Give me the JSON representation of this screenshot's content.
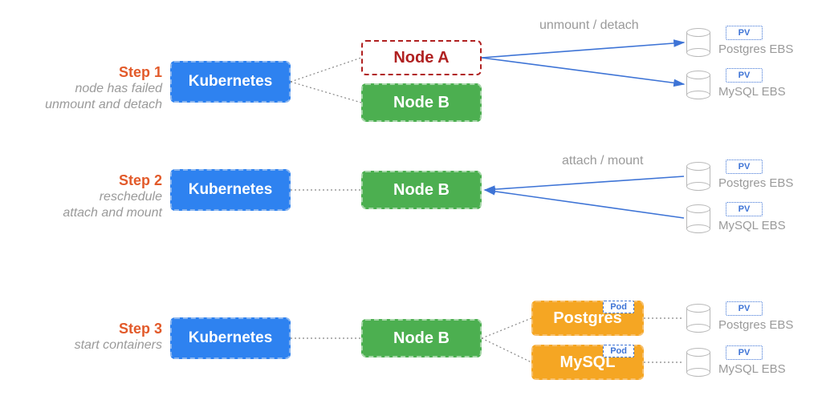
{
  "steps": [
    {
      "title": "Step 1",
      "sub": "node has failed\nunmount and detach"
    },
    {
      "title": "Step 2",
      "sub": "reschedule\nattach and mount"
    },
    {
      "title": "Step 3",
      "sub": "start containers"
    }
  ],
  "labels": {
    "kubernetes": "Kubernetes",
    "nodeA": "Node A",
    "nodeB": "Node B",
    "pv": "PV",
    "podTag": "Pod",
    "pods": {
      "postgres": "Postgres",
      "mysql": "MySQL"
    },
    "ebs": {
      "postgres": "Postgres EBS",
      "mysql": "MySQL EBS"
    },
    "actions": {
      "unmountDetach": "unmount / detach",
      "attachMount": "attach / mount"
    }
  }
}
